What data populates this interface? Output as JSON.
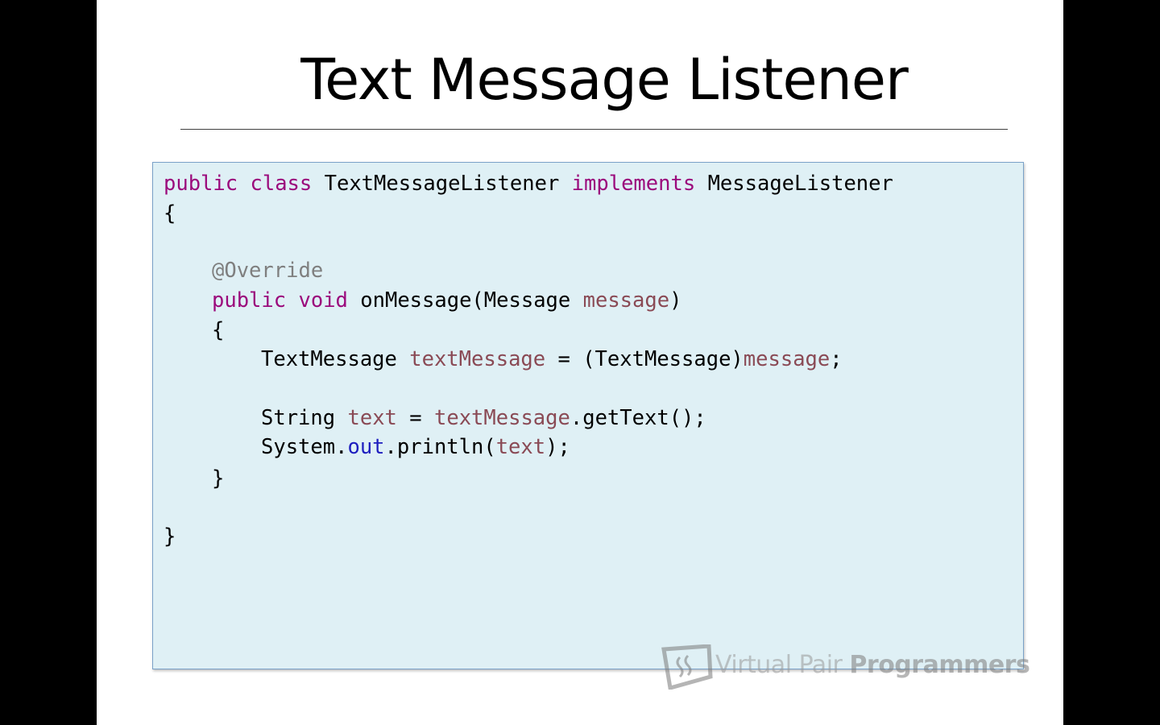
{
  "slide": {
    "title": "Text Message Listener"
  },
  "code": {
    "line1": {
      "kw1": "public",
      "kw2": "class",
      "name": "TextMessageListener",
      "kw3": "implements",
      "iface": "MessageListener"
    },
    "line2": "{",
    "line4": "@Override",
    "line5": {
      "kw1": "public",
      "kw2": "void",
      "method": "onMessage(Message",
      "param": "message",
      "close": ")"
    },
    "line6": "{",
    "line7": {
      "type": "TextMessage",
      "var": "textMessage",
      "mid": "= (TextMessage)",
      "ref": "message",
      "end": ";"
    },
    "line9": {
      "type": "String",
      "var": "text",
      "eq": "=",
      "ref": "textMessage",
      "call": ".getText();"
    },
    "line10": {
      "obj": "System.",
      "field": "out",
      "call": ".println(",
      "arg": "text",
      "end": ");"
    },
    "line11": "}",
    "line13": "}"
  },
  "watermark": {
    "brand_light": "Virtual Pair ",
    "brand_bold": "Programmers",
    "logo_icon": "vpp-logo-icon"
  }
}
